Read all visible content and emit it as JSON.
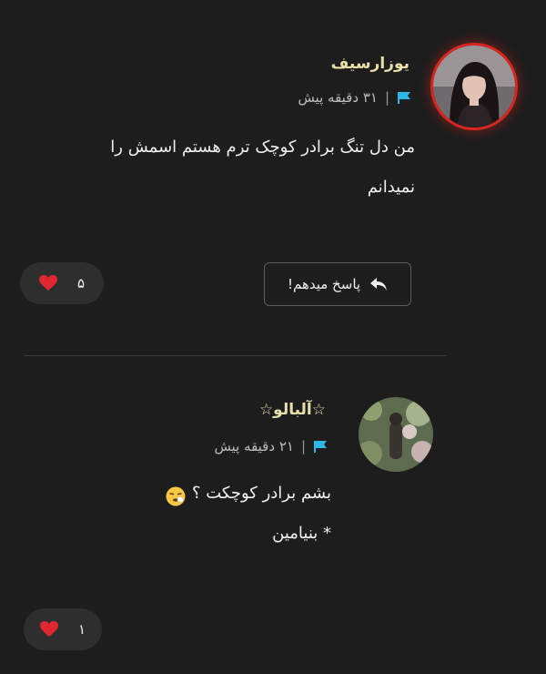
{
  "comments": [
    {
      "username": "یوزارسیف",
      "time": "۳۱ دقیقه پیش",
      "separator": "|",
      "body_line1": "من دل تنگ برادر کوچک ترم هستم اسمش را",
      "body_line2": "نمیدانم",
      "reply_label": "پاسخ میدهم!",
      "likes": "۵",
      "avatar_icon": "profile-photo-girl",
      "avatar_ring_color": "#d8261f"
    },
    {
      "username": "☆آلبالو☆",
      "time": "۲۱ دقیقه پیش",
      "separator": "|",
      "body_line1": "بشم برادر کوچکت ؟",
      "body_line2": "* بنیامین",
      "emoji_icon": "sneezing-face-emoji",
      "likes": "۱",
      "avatar_icon": "profile-photo-garden"
    }
  ],
  "colors": {
    "background": "#1d1d1d",
    "username": "#e8e0a8",
    "flag": "#2fb6e8",
    "heart": "#e0262f"
  }
}
